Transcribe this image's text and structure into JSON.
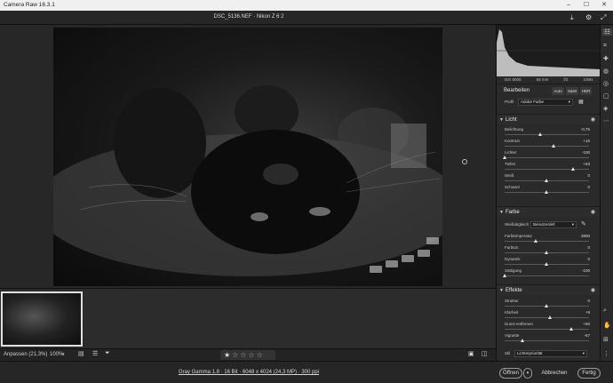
{
  "window": {
    "title": "Camera Raw 16.3.1"
  },
  "file": {
    "name": "DSC_5136.NEF · Nikon Z 6 2"
  },
  "histogram": {
    "iso": "ISO 8000",
    "focal": "58 mm",
    "aperture": "f/2",
    "shutter": "1/80s"
  },
  "panel": {
    "title": "Bearbeiten",
    "modes": [
      "Auto",
      "S&W",
      "HDR"
    ],
    "profile_label": "Profil",
    "profile_value": "Adobe Farbe"
  },
  "sections": {
    "licht": {
      "title": "Licht",
      "sliders": [
        {
          "label": "Belichtung",
          "value": "-0,75",
          "pos": -0.15
        },
        {
          "label": "Kontrast",
          "value": "+16",
          "pos": 0.16
        },
        {
          "label": "Lichter",
          "value": "-100",
          "pos": -1.0
        },
        {
          "label": "Tiefen",
          "value": "+63",
          "pos": 0.63
        },
        {
          "label": "Weiß",
          "value": "0",
          "pos": 0
        },
        {
          "label": "Schwarz",
          "value": "0",
          "pos": 0
        }
      ]
    },
    "farbe": {
      "title": "Farbe",
      "wb_label": "Weißabgleich",
      "wb_value": "Benutzerdef.",
      "sliders": [
        {
          "label": "Farbtemperatur",
          "value": "3900",
          "pos": -0.25
        },
        {
          "label": "Farbton",
          "value": "0",
          "pos": 0
        },
        {
          "label": "Dynamik",
          "value": "0",
          "pos": 0
        },
        {
          "label": "Sättigung",
          "value": "-100",
          "pos": -1.0
        }
      ]
    },
    "effekte": {
      "title": "Effekte",
      "sliders": [
        {
          "label": "Struktur",
          "value": "0",
          "pos": 0
        },
        {
          "label": "Klarheit",
          "value": "+9",
          "pos": 0.09
        },
        {
          "label": "Dunst entfernen",
          "value": "+60",
          "pos": 0.6
        },
        {
          "label": "Vignette",
          "value": "-57",
          "pos": -0.57
        }
      ],
      "style_label": "Stil",
      "style_value": "Lichterpriorität"
    }
  },
  "status": {
    "zoom_fit": "Anpassen (21,3%)",
    "zoom": "100%"
  },
  "bottom": {
    "info": "Gray Gamma 1.8 · 16 Bit · 6048 x 4024 (24,3 MP) · 300 ppi",
    "open": "Öffnen",
    "cancel": "Abbrechen",
    "done": "Fertig"
  }
}
